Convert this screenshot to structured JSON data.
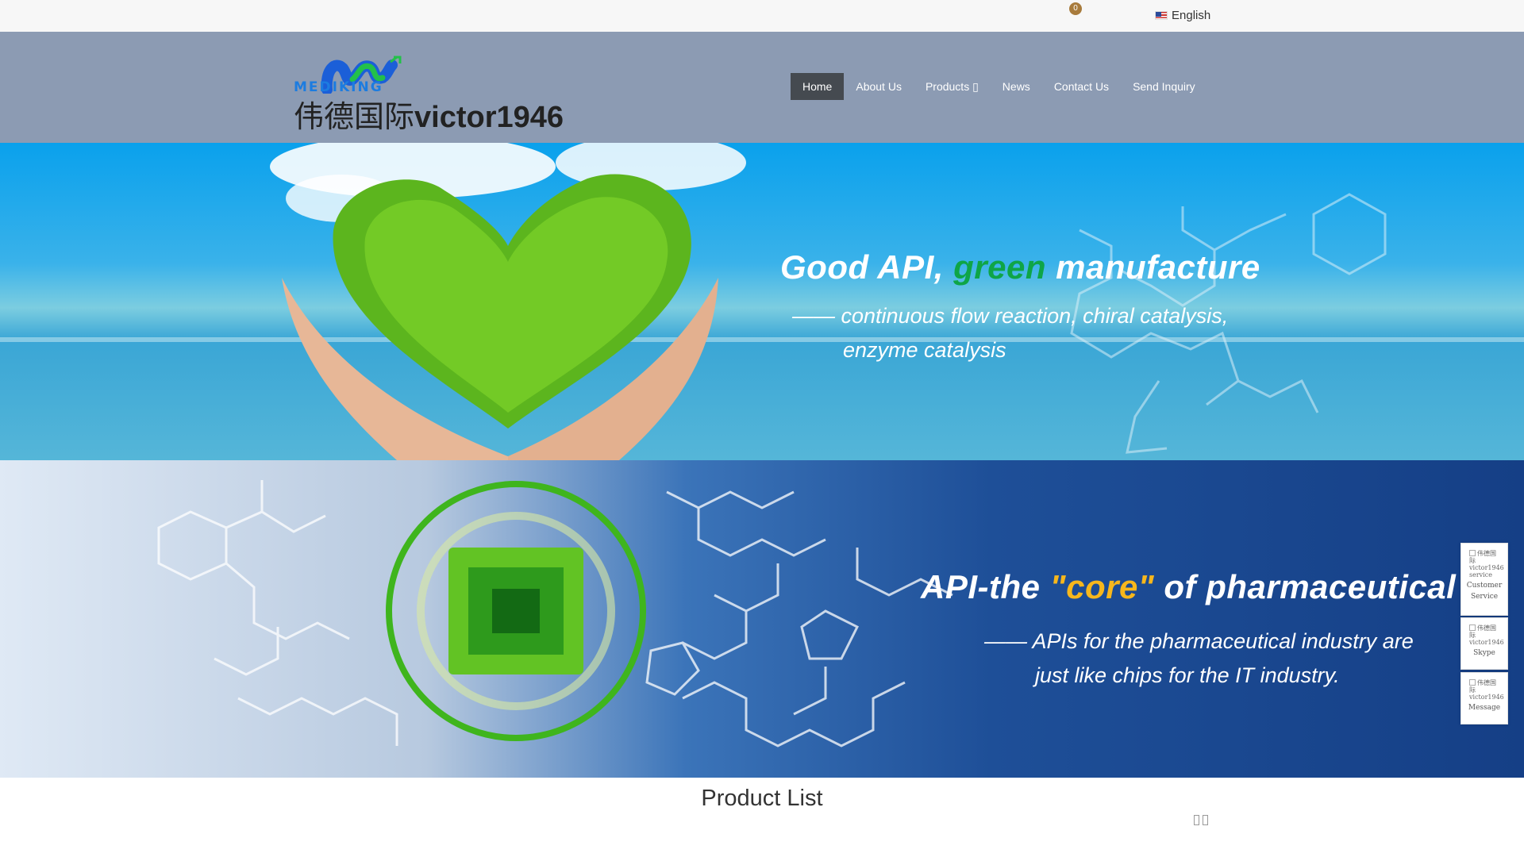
{
  "topbar": {
    "cart_count": "0",
    "language": "English"
  },
  "header": {
    "logo_word": "MEDIKING",
    "site_name_cn": "伟德国际",
    "site_name_en": "victor1946"
  },
  "nav": {
    "items": [
      {
        "label": "Home"
      },
      {
        "label": "About Us"
      },
      {
        "label": "Products ▯"
      },
      {
        "label": "News"
      },
      {
        "label": "Contact Us"
      },
      {
        "label": "Send Inquiry"
      }
    ]
  },
  "banner1": {
    "headline_a": "Good API, ",
    "headline_b": "green",
    "headline_c": " manufacture",
    "sub_line1": "—— continuous flow reaction, chiral catalysis,",
    "sub_line2": "enzyme catalysis"
  },
  "banner2": {
    "headline_a": "API-the ",
    "headline_b": "\"core\"",
    "headline_c": " of pharmaceutical",
    "sub_line1": "—— APIs for the pharmaceutical industry are",
    "sub_line2": "just like chips for the IT industry."
  },
  "products": {
    "title": "Product List"
  },
  "float_contact": {
    "img_alt": "伟德国际victor1946",
    "service_img_alt": "伟德国际victor1946 service",
    "customer_service_line1": "Customer",
    "customer_service_line2": "Service",
    "skype": "Skype",
    "message": "Message"
  },
  "colors": {
    "header_bg": "#8c9bb3",
    "nav_active": "#454a50",
    "green_accent": "#0ea547",
    "gold_accent": "#f7b71c"
  }
}
